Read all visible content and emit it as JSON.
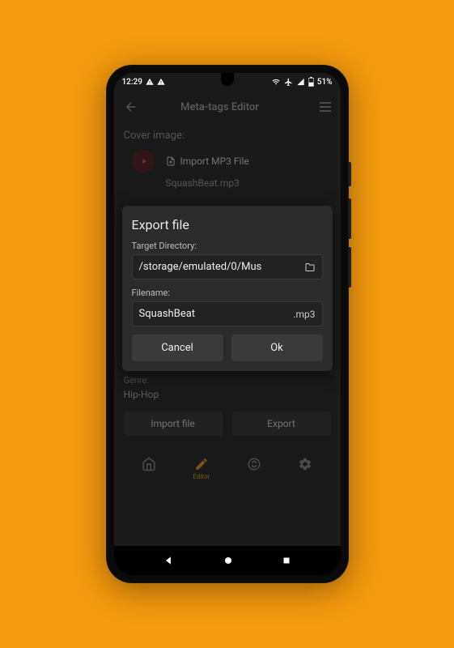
{
  "status": {
    "time": "12:29",
    "battery": "51%"
  },
  "toolbar": {
    "title": "Meta-tags Editor"
  },
  "cover": {
    "section_label": "Cover image:",
    "import_label": "Import MP3 File",
    "current_file": "SquashBeat.mp3"
  },
  "genre_section": {
    "label": "Genre:",
    "value": "Hip-Hop"
  },
  "bottom_buttons": {
    "import": "Import file",
    "export": "Export"
  },
  "nav": {
    "editor_label": "Editor"
  },
  "dialog": {
    "title": "Export file",
    "dir_label": "Target Directory:",
    "dir_value": "/storage/emulated/0/Mus",
    "filename_label": "Filename:",
    "filename_value": "SquashBeat",
    "filename_ext": ".mp3",
    "cancel": "Cancel",
    "ok": "Ok"
  }
}
